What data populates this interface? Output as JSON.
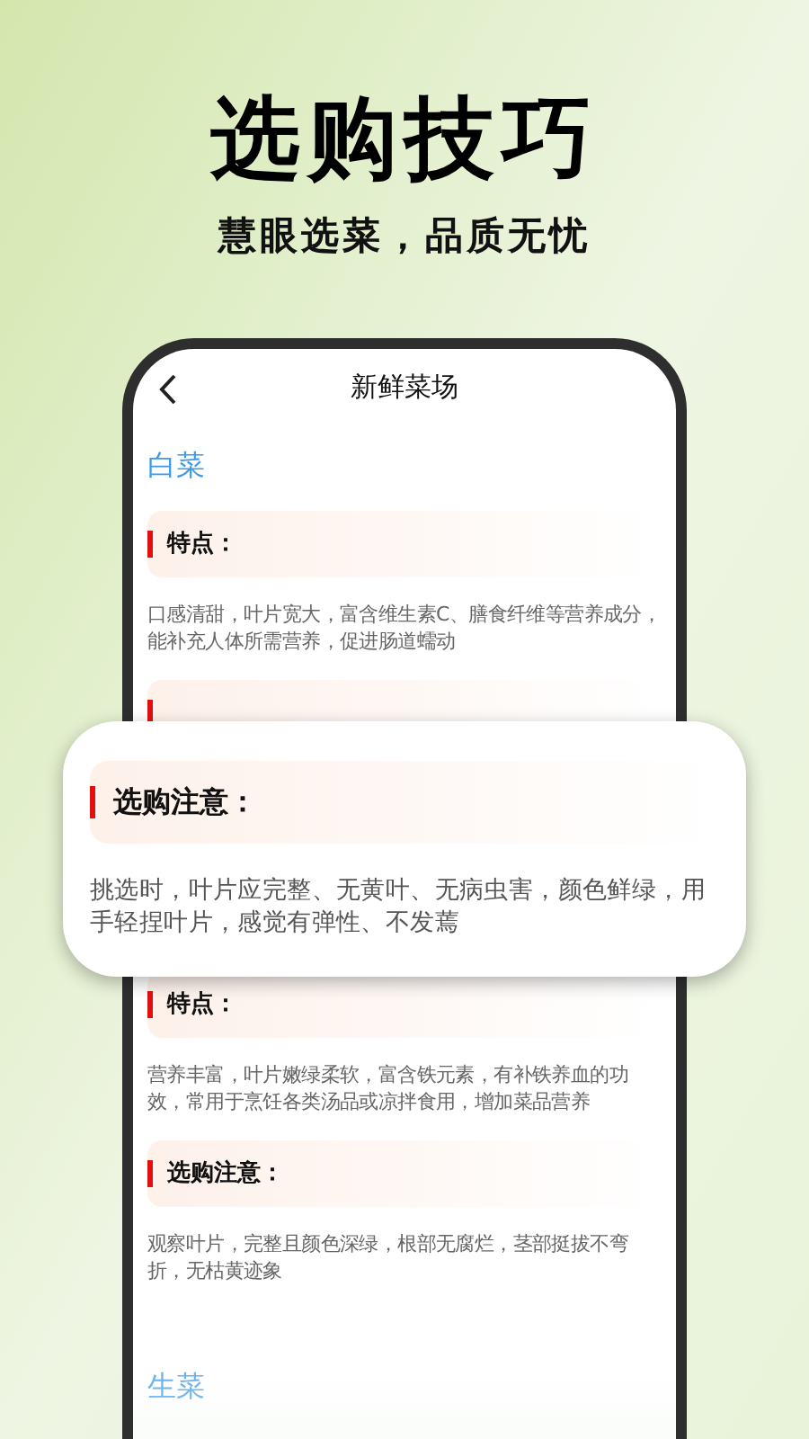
{
  "hero": {
    "title": "选购技巧",
    "subtitle": "慧眼选菜，品质无忧"
  },
  "screen": {
    "title": "新鲜菜场",
    "blocks": [
      {
        "kind": "category",
        "name": "白菜"
      },
      {
        "kind": "section",
        "heading": "特点：",
        "text": "口感清甜，叶片宽大，富含维生素C、膳食纤维等营养成分，能补充人体所需营养，促进肠道蠕动"
      },
      {
        "kind": "covered"
      },
      {
        "kind": "section",
        "heading": "特点：",
        "text": "营养丰富，叶片嫩绿柔软，富含铁元素，有补铁养血的功效，常用于烹饪各类汤品或凉拌食用，增加菜品营养"
      },
      {
        "kind": "section",
        "heading": "选购注意：",
        "text": "观察叶片，完整且颜色深绿，根部无腐烂，茎部挺拔不弯折，无枯黄迹象"
      },
      {
        "kind": "category",
        "name": "生菜"
      }
    ]
  },
  "popup": {
    "heading": "选购注意：",
    "text": "挑选时，叶片应完整、无黄叶、无病虫害，颜色鲜绿，用手轻捏叶片，感觉有弹性、不发蔫"
  }
}
